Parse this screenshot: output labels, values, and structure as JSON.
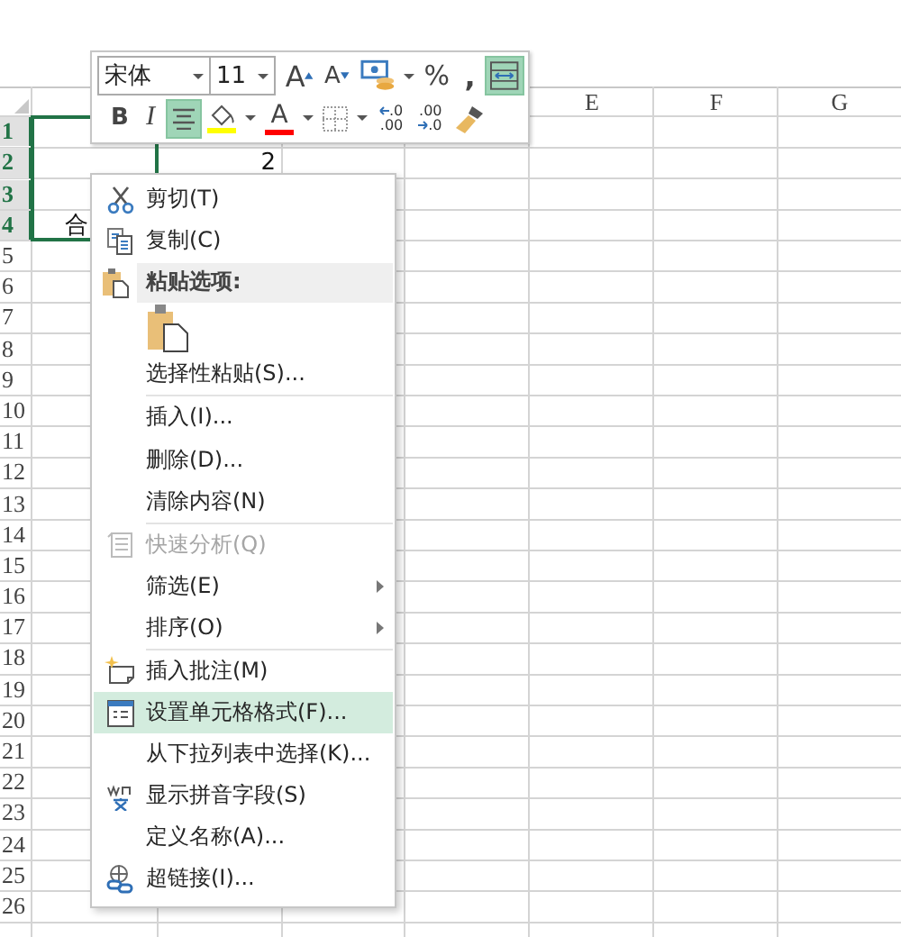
{
  "sheet": {
    "columns": [
      {
        "label": "E"
      },
      {
        "label": "F"
      },
      {
        "label": "G"
      }
    ],
    "rows": [
      {
        "label": "1",
        "selected": true
      },
      {
        "label": "2",
        "selected": true
      },
      {
        "label": "3",
        "selected": true
      },
      {
        "label": "4",
        "selected": true
      },
      {
        "label": "5",
        "selected": false
      },
      {
        "label": "6",
        "selected": false
      },
      {
        "label": "7",
        "selected": false
      },
      {
        "label": "8",
        "selected": false
      },
      {
        "label": "9",
        "selected": false
      },
      {
        "label": "10",
        "selected": false
      },
      {
        "label": "11",
        "selected": false
      },
      {
        "label": "12",
        "selected": false
      },
      {
        "label": "13",
        "selected": false
      },
      {
        "label": "14",
        "selected": false
      },
      {
        "label": "15",
        "selected": false
      },
      {
        "label": "16",
        "selected": false
      },
      {
        "label": "17",
        "selected": false
      },
      {
        "label": "18",
        "selected": false
      },
      {
        "label": "19",
        "selected": false
      },
      {
        "label": "20",
        "selected": false
      },
      {
        "label": "21",
        "selected": false
      },
      {
        "label": "22",
        "selected": false
      },
      {
        "label": "23",
        "selected": false
      },
      {
        "label": "24",
        "selected": false
      },
      {
        "label": "25",
        "selected": false
      },
      {
        "label": "26",
        "selected": false
      }
    ],
    "cells": [
      {
        "text": "2"
      },
      {
        "text": "合"
      }
    ]
  },
  "mini_toolbar": {
    "rows": [
      [
        {
          "kind": "font-name",
          "value": "宋体"
        },
        {
          "kind": "font-size",
          "value": "11"
        },
        {
          "kind": "grow-font",
          "label": "A"
        },
        {
          "kind": "shrink-font",
          "label": "A"
        },
        {
          "kind": "accounting"
        },
        {
          "kind": "dropdown"
        },
        {
          "kind": "percent",
          "label": "%"
        },
        {
          "kind": "comma",
          "label": ","
        },
        {
          "kind": "wrap",
          "selected": true
        }
      ],
      [
        {
          "kind": "bold",
          "label": "B",
          "selected": false
        },
        {
          "kind": "italic",
          "label": "I",
          "selected": false
        },
        {
          "kind": "align-center",
          "selected": true
        },
        {
          "kind": "fill-color",
          "color": "#ffff00"
        },
        {
          "kind": "dropdown"
        },
        {
          "kind": "font-color",
          "label": "A",
          "color": "#ff0000"
        },
        {
          "kind": "dropdown"
        },
        {
          "kind": "borders"
        },
        {
          "kind": "dropdown"
        },
        {
          "kind": "increase-decimal",
          "top": ".0",
          "bottom": ".00"
        },
        {
          "kind": "decrease-decimal",
          "top": ".00",
          "bottom": ".0"
        },
        {
          "kind": "format-painter"
        }
      ]
    ]
  },
  "context_menu": {
    "items": [
      {
        "kind": "item",
        "label": "剪切(T)",
        "disabled": false,
        "selected": false,
        "submenu": false
      },
      {
        "kind": "item",
        "label": "复制(C)",
        "disabled": false,
        "selected": false,
        "submenu": false
      },
      {
        "kind": "header",
        "label": "粘贴选项:"
      },
      {
        "kind": "paste-option"
      },
      {
        "kind": "item",
        "label": "选择性粘贴(S)...",
        "disabled": false,
        "selected": false,
        "submenu": false
      },
      {
        "kind": "separator"
      },
      {
        "kind": "item",
        "label": "插入(I)...",
        "disabled": false,
        "selected": false,
        "submenu": false
      },
      {
        "kind": "item",
        "label": "删除(D)...",
        "disabled": false,
        "selected": false,
        "submenu": false
      },
      {
        "kind": "item",
        "label": "清除内容(N)",
        "disabled": false,
        "selected": false,
        "submenu": false
      },
      {
        "kind": "separator"
      },
      {
        "kind": "item",
        "label": "快速分析(Q)",
        "disabled": true,
        "selected": false,
        "submenu": false
      },
      {
        "kind": "item",
        "label": "筛选(E)",
        "disabled": false,
        "selected": false,
        "submenu": true
      },
      {
        "kind": "item",
        "label": "排序(O)",
        "disabled": false,
        "selected": false,
        "submenu": true
      },
      {
        "kind": "separator"
      },
      {
        "kind": "item",
        "label": "插入批注(M)",
        "disabled": false,
        "selected": false,
        "submenu": false
      },
      {
        "kind": "item",
        "label": "设置单元格格式(F)...",
        "disabled": false,
        "selected": true,
        "submenu": false
      },
      {
        "kind": "item",
        "label": "从下拉列表中选择(K)...",
        "disabled": false,
        "selected": false,
        "submenu": false
      },
      {
        "kind": "item",
        "label": "显示拼音字段(S)",
        "disabled": false,
        "selected": false,
        "submenu": false
      },
      {
        "kind": "item",
        "label": "定义名称(A)...",
        "disabled": false,
        "selected": false,
        "submenu": false
      },
      {
        "kind": "item",
        "label": "超链接(I)...",
        "disabled": false,
        "selected": false,
        "submenu": false
      }
    ]
  }
}
